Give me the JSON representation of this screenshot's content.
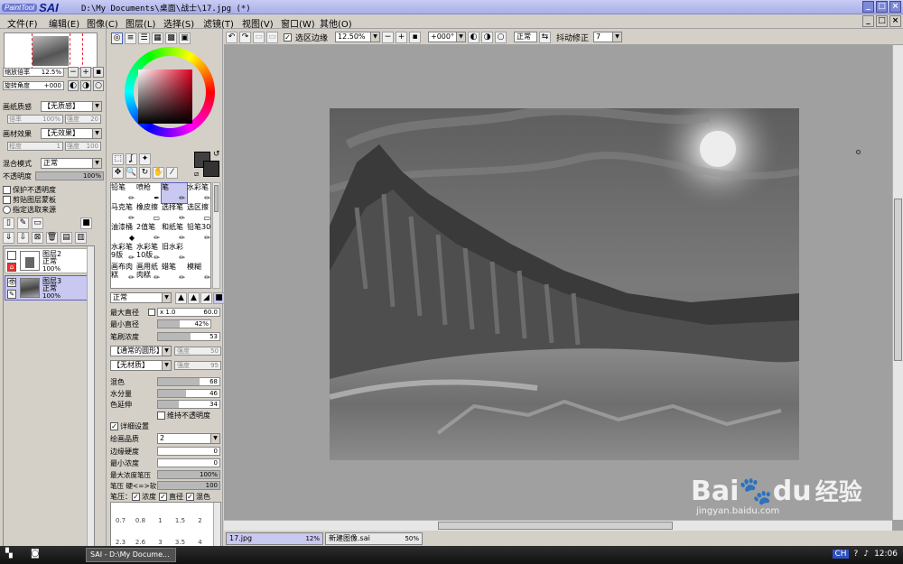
{
  "window": {
    "logo_small": "PaintTool",
    "logo_big": "SAI",
    "title": "D:\\My Documents\\桌面\\战士\\17.jpg (*)"
  },
  "menu": [
    "文件(F)",
    "编辑(E)",
    "图像(C)",
    "图层(L)",
    "选择(S)",
    "滤镜(T)",
    "视图(V)",
    "窗口(W)",
    "其他(O)"
  ],
  "nav": {
    "zoom_label": "缩放倍率",
    "zoom_value": "12.5%",
    "angle_label": "旋转角度",
    "angle_value": "+000"
  },
  "layer_props": {
    "paper_label": "画纸质感",
    "paper_value": "【无质感】",
    "strength1_label": "倍率",
    "strength1_value": "100%",
    "strength2_label": "强度",
    "strength2_value": "20",
    "material_label": "画材效果",
    "material_value": "【无效果】",
    "degree_label": "程度",
    "degree_value": "1",
    "strength3_label": "强度",
    "strength3_value": "100",
    "blend_label": "混合模式",
    "blend_value": "正常",
    "opacity_label": "不透明度",
    "opacity_value": "100%",
    "checks": [
      "保护不透明度",
      "剪贴图层蒙板",
      "指定选取来源"
    ]
  },
  "layers": [
    {
      "name": "图层2",
      "mode": "正常",
      "opacity": "100%"
    },
    {
      "name": "图层3",
      "mode": "正常",
      "opacity": "100%"
    }
  ],
  "brushes": [
    {
      "name": "铅笔",
      "icon": "✏"
    },
    {
      "name": "喷枪",
      "icon": "✒"
    },
    {
      "name": "笔",
      "icon": "✏"
    },
    {
      "name": "水彩笔",
      "icon": "✏"
    },
    {
      "name": "马克笔",
      "icon": "✏"
    },
    {
      "name": "橡皮擦",
      "icon": "▭"
    },
    {
      "name": "选择笔",
      "icon": "✏"
    },
    {
      "name": "选区擦",
      "icon": "▭"
    },
    {
      "name": "油漆桶",
      "icon": "◆"
    },
    {
      "name": "2值笔",
      "icon": "✏"
    },
    {
      "name": "和纸笔",
      "icon": "✏"
    },
    {
      "name": "铅笔30",
      "icon": "✏"
    },
    {
      "name": "水彩笔9版",
      "icon": "✏"
    },
    {
      "name": "水彩笔10版",
      "icon": "✏"
    },
    {
      "name": "旧水彩",
      "icon": "✏"
    },
    {
      "name": "",
      "icon": ""
    },
    {
      "name": "画布肉糕",
      "icon": "✏"
    },
    {
      "name": "画用纸肉糕",
      "icon": "✏"
    },
    {
      "name": "蜡笔",
      "icon": "✏"
    },
    {
      "name": "模糊",
      "icon": "✏"
    }
  ],
  "brush_settings": {
    "mode": "正常",
    "max_diam_label": "最大直径",
    "max_diam_mult": "x 1.0",
    "max_diam_value": "60.0",
    "min_diam_label": "最小直径",
    "min_diam_value": "42%",
    "density_label": "笔刷浓度",
    "density_value": "53",
    "shape_value": "【通常的圆形】",
    "shape_strength_label": "强度",
    "shape_strength_value": "50",
    "texture_value": "【无材质】",
    "texture_strength_label": "强度",
    "texture_strength_value": "95",
    "blend_label": "混色",
    "blend_value": "68",
    "water_label": "水分量",
    "water_value": "46",
    "color_ext_label": "色延伸",
    "color_ext_value": "34",
    "keep_opacity_label": "维持不透明度",
    "detail_label": "详细设置",
    "quality_label": "绘画品质",
    "quality_value": "2",
    "edge_label": "边缘硬度",
    "edge_value": "0",
    "min_density_label": "最小浓度",
    "min_density_value": "0",
    "max_density_pressure_label": "最大浓度笔压",
    "max_density_pressure_value": "100%",
    "pressure_hardness_label": "笔压 硬<=>软",
    "pressure_hardness_value": "100",
    "pressure_label": "笔压：",
    "pressure_checks": [
      "浓度",
      "直径",
      "混色"
    ]
  },
  "brush_sizes": [
    "0.7",
    "0.8",
    "1",
    "1.5",
    "2",
    "2.3",
    "2.6",
    "3",
    "3.5",
    "4"
  ],
  "canvas_toolbar": {
    "sel_edge_label": "选区边缘",
    "zoom": "12.50%",
    "angle": "+000°",
    "mode": "正常",
    "stabilizer_label": "抖动修正",
    "stabilizer_value": "7"
  },
  "doc_tabs": [
    {
      "name": "17.jpg",
      "zoom": "12%"
    },
    {
      "name": "新建图像.sai",
      "zoom": "50%"
    }
  ],
  "taskbar": {
    "task": "SAI - D:\\My Docume...",
    "ime": "CH",
    "time": "12:06"
  },
  "watermark": {
    "brand": "Bai",
    "brand2": "du",
    "brand3": "经验",
    "url": "jingyan.baidu.com"
  }
}
